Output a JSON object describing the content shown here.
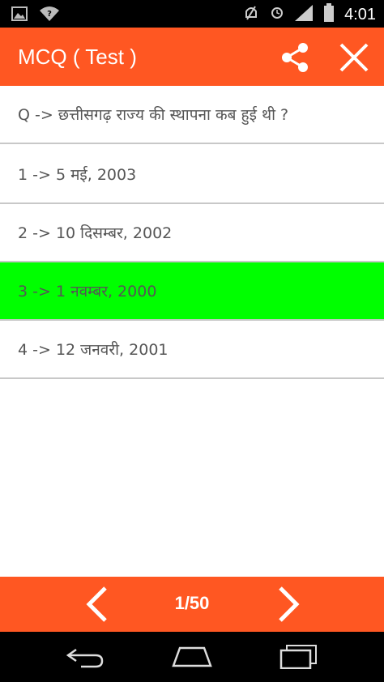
{
  "status": {
    "time": "4:01"
  },
  "app": {
    "title": "MCQ ( Test )"
  },
  "question": "Q -> छत्तीसगढ़ राज्य की स्थापना कब हुई थी ?",
  "options": [
    "1 -> 5 मई, 2003",
    "2 -> 10 दिसम्बर, 2002",
    "3 -> 1 नवम्बर, 2000",
    "4 -> 12 जनवरी, 2001"
  ],
  "selected_option": 3,
  "colors": {
    "accent": "#ff5722",
    "selected": "#00ff00",
    "divider": "#c8c8c8"
  },
  "pagination": {
    "label": "1/50"
  },
  "icons": [
    "gallery-icon",
    "wifi-question-icon",
    "mute-icon",
    "alarm-icon",
    "signal-icon",
    "battery-icon",
    "share-icon",
    "close-icon",
    "chevron-left-icon",
    "chevron-right-icon",
    "back-icon",
    "home-icon",
    "recent-apps-icon"
  ]
}
